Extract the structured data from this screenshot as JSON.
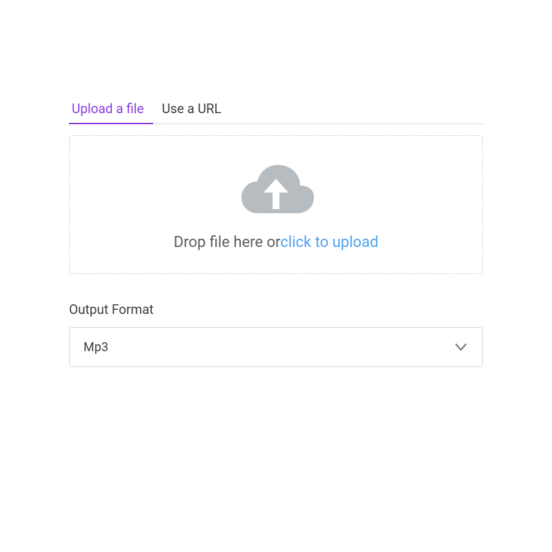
{
  "tabs": {
    "upload": "Upload a file",
    "url": "Use a URL"
  },
  "dropzone": {
    "prefix": "Drop file here or",
    "link": "click to upload",
    "icon": "cloud-upload-icon"
  },
  "output": {
    "label": "Output Format",
    "selected": "Mp3"
  },
  "colors": {
    "accent": "#8a3be0",
    "link": "#4ea3f0",
    "iconFill": "#b7bcc1"
  }
}
